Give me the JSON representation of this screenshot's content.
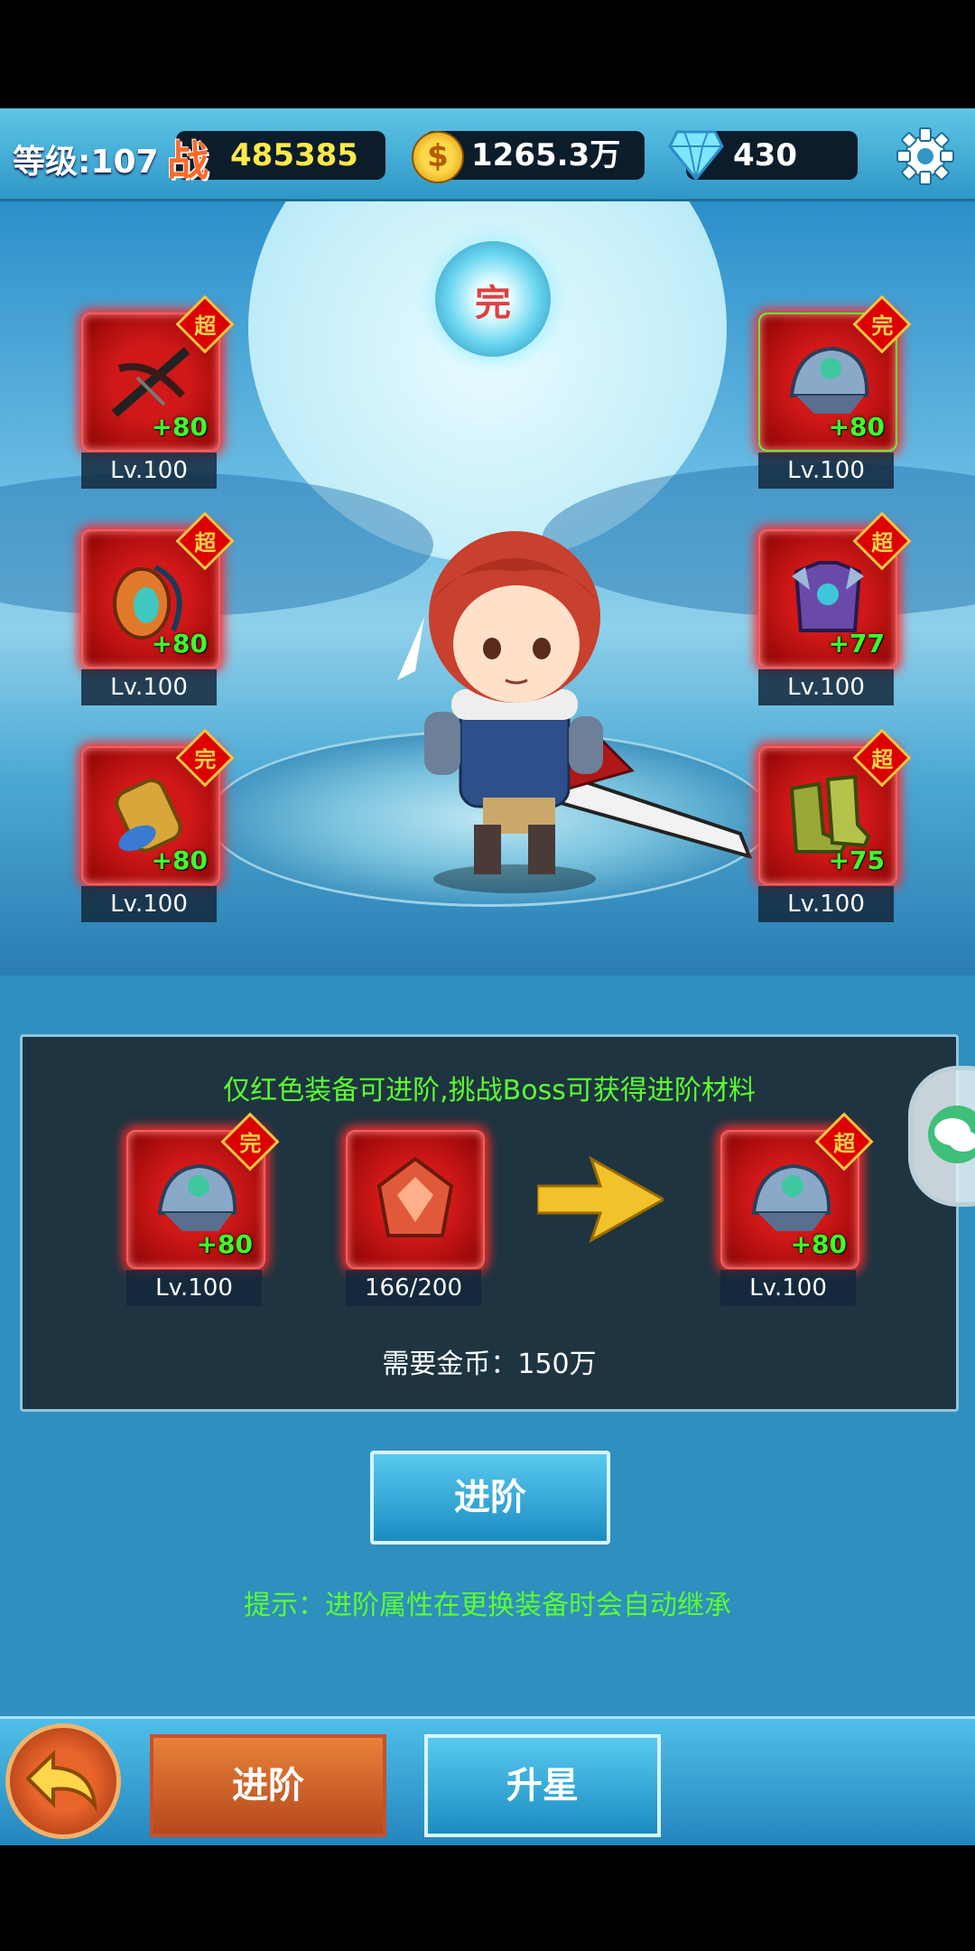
{
  "status_bar": {
    "level": "等级:107",
    "power_icon_text": "战",
    "power": "485385",
    "gold": "1265.3万",
    "diamonds": "430"
  },
  "rank_emblem_text": "完",
  "equipment_left": [
    {
      "tag": "超",
      "plus": "+80",
      "level": "Lv.100",
      "icon": "crossbow-icon"
    },
    {
      "tag": "超",
      "plus": "+80",
      "level": "Lv.100",
      "icon": "amulet-icon"
    },
    {
      "tag": "完",
      "plus": "+80",
      "level": "Lv.100",
      "icon": "bracer-icon"
    }
  ],
  "equipment_right": [
    {
      "tag": "完",
      "plus": "+80",
      "level": "Lv.100",
      "icon": "helmet-icon"
    },
    {
      "tag": "超",
      "plus": "+77",
      "level": "Lv.100",
      "icon": "armor-icon"
    },
    {
      "tag": "超",
      "plus": "+75",
      "level": "Lv.100",
      "icon": "boots-icon"
    }
  ],
  "advance_panel": {
    "hint": "仅红色装备可进阶,挑战Boss可获得进阶材料",
    "current_item": {
      "tag": "完",
      "plus": "+80",
      "level": "Lv.100"
    },
    "material": {
      "count": "166/200"
    },
    "result_item": {
      "tag": "超",
      "plus": "+80",
      "level": "Lv.100"
    },
    "cost": "需要金币：150万"
  },
  "advance_button": "进阶",
  "tip": "提示：进阶属性在更换装备时会自动继承",
  "tabs": {
    "advance": "进阶",
    "star_up": "升星"
  },
  "colors": {
    "accent_green": "#5cff2e",
    "gold_text": "#ffe94a",
    "equip_red": "#d01818"
  }
}
